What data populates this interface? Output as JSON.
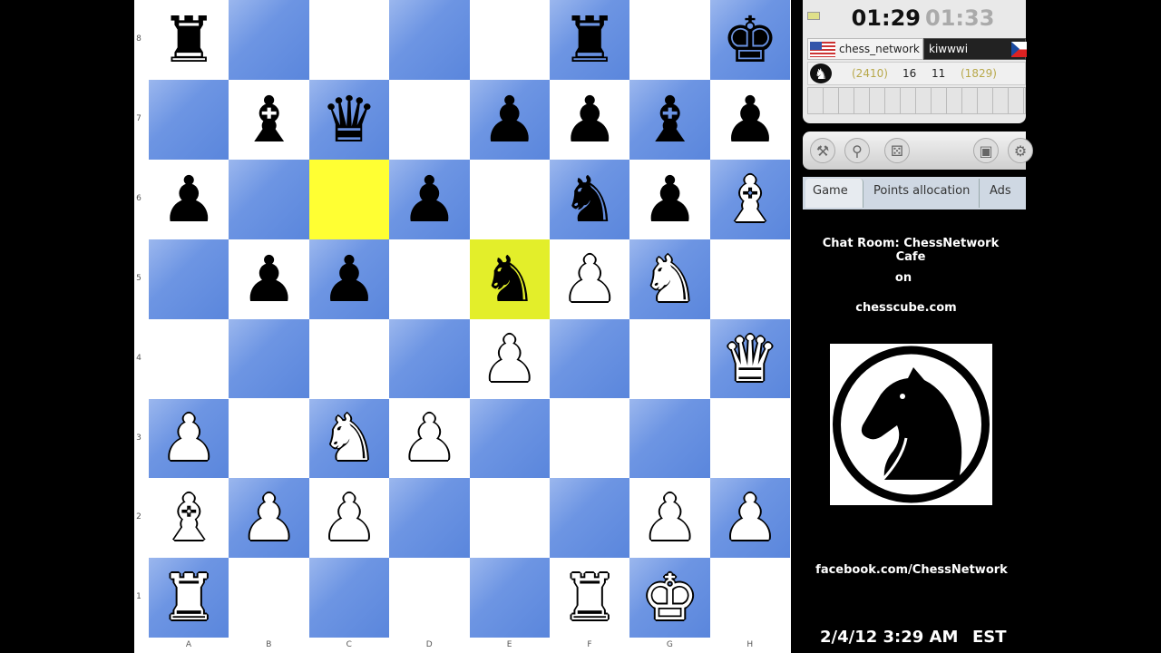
{
  "board": {
    "ranks": [
      "8",
      "7",
      "6",
      "5",
      "4",
      "3",
      "2",
      "1"
    ],
    "files": [
      "A",
      "B",
      "C",
      "D",
      "E",
      "F",
      "G",
      "H"
    ],
    "highlights": {
      "c6": "last-move-from",
      "e5": "last-move-to"
    },
    "pieces": [
      {
        "sq": "a8",
        "color": "black",
        "type": "rook",
        "glyph": "♜"
      },
      {
        "sq": "f8",
        "color": "black",
        "type": "rook",
        "glyph": "♜"
      },
      {
        "sq": "h8",
        "color": "black",
        "type": "king",
        "glyph": "♚"
      },
      {
        "sq": "b7",
        "color": "black",
        "type": "bishop",
        "glyph": "♝"
      },
      {
        "sq": "c7",
        "color": "black",
        "type": "queen",
        "glyph": "♛"
      },
      {
        "sq": "e7",
        "color": "black",
        "type": "pawn",
        "glyph": "♟"
      },
      {
        "sq": "f7",
        "color": "black",
        "type": "pawn",
        "glyph": "♟"
      },
      {
        "sq": "g7",
        "color": "black",
        "type": "bishop",
        "glyph": "♝"
      },
      {
        "sq": "h7",
        "color": "black",
        "type": "pawn",
        "glyph": "♟"
      },
      {
        "sq": "a6",
        "color": "black",
        "type": "pawn",
        "glyph": "♟"
      },
      {
        "sq": "d6",
        "color": "black",
        "type": "pawn",
        "glyph": "♟"
      },
      {
        "sq": "f6",
        "color": "black",
        "type": "knight",
        "glyph": "♞"
      },
      {
        "sq": "g6",
        "color": "black",
        "type": "pawn",
        "glyph": "♟"
      },
      {
        "sq": "h6",
        "color": "white",
        "type": "bishop",
        "glyph": "♝"
      },
      {
        "sq": "b5",
        "color": "black",
        "type": "pawn",
        "glyph": "♟"
      },
      {
        "sq": "c5",
        "color": "black",
        "type": "pawn",
        "glyph": "♟"
      },
      {
        "sq": "e5",
        "color": "black",
        "type": "knight",
        "glyph": "♞"
      },
      {
        "sq": "f5",
        "color": "white",
        "type": "pawn",
        "glyph": "♟"
      },
      {
        "sq": "g5",
        "color": "white",
        "type": "knight",
        "glyph": "♞"
      },
      {
        "sq": "e4",
        "color": "white",
        "type": "pawn",
        "glyph": "♟"
      },
      {
        "sq": "h4",
        "color": "white",
        "type": "queen",
        "glyph": "♛"
      },
      {
        "sq": "a3",
        "color": "white",
        "type": "pawn",
        "glyph": "♟"
      },
      {
        "sq": "c3",
        "color": "white",
        "type": "knight",
        "glyph": "♞"
      },
      {
        "sq": "d3",
        "color": "white",
        "type": "pawn",
        "glyph": "♟"
      },
      {
        "sq": "a2",
        "color": "white",
        "type": "bishop",
        "glyph": "♝"
      },
      {
        "sq": "b2",
        "color": "white",
        "type": "pawn",
        "glyph": "♟"
      },
      {
        "sq": "c2",
        "color": "white",
        "type": "pawn",
        "glyph": "♟"
      },
      {
        "sq": "g2",
        "color": "white",
        "type": "pawn",
        "glyph": "♟"
      },
      {
        "sq": "h2",
        "color": "white",
        "type": "pawn",
        "glyph": "♟"
      },
      {
        "sq": "a1",
        "color": "white",
        "type": "rook",
        "glyph": "♜"
      },
      {
        "sq": "f1",
        "color": "white",
        "type": "rook",
        "glyph": "♜"
      },
      {
        "sq": "g1",
        "color": "white",
        "type": "king",
        "glyph": "♚"
      }
    ]
  },
  "clocks": {
    "white_time": "01:29",
    "black_time": "01:33"
  },
  "players": {
    "white": {
      "name": "chess_network",
      "rating": "(2410)",
      "score": "16",
      "flag": "us-flag-icon"
    },
    "black": {
      "name": "kiwwwi",
      "rating": "(1829)",
      "score": "11",
      "flag": "cz-flag-icon"
    }
  },
  "toolbar": {
    "icons": [
      "hammer-icon",
      "handshake-icon",
      "dice-icon",
      "save-icon",
      "settings-icon"
    ]
  },
  "tabs": [
    {
      "label": "Game",
      "active": true
    },
    {
      "label": "Points allocation",
      "active": false
    },
    {
      "label": "Ads",
      "active": false
    }
  ],
  "overlay": {
    "chat_room": "Chat Room: ChessNetwork Cafe",
    "on": "on",
    "site": "chesscube.com",
    "facebook": "facebook.com/ChessNetwork",
    "datetime": "2/4/12 3:29 AM",
    "timezone": "EST"
  }
}
